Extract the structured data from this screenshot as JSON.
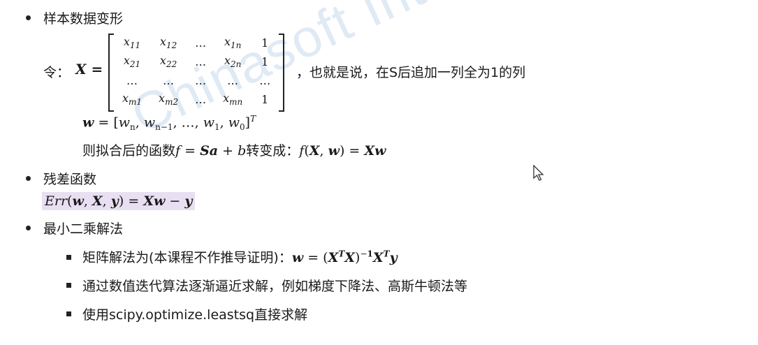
{
  "watermark": "Chinasoft International",
  "s1": {
    "bullet": "样本数据变形",
    "let_label": "令：",
    "x_symbol": "X",
    "matrix": [
      [
        "x11",
        "x12",
        "...",
        "x1n",
        "1"
      ],
      [
        "x21",
        "x22",
        "...",
        "x2n",
        "1"
      ],
      [
        "...",
        "...",
        "...",
        "...",
        "..."
      ],
      [
        "xm1",
        "xm2",
        "...",
        "xmn",
        "1"
      ]
    ],
    "after_matrix": "，也就是说，在S后追加一列全为1的列",
    "w_def": "w = [wn, wn−1, …, w1, w0]T",
    "fit_prefix": "则拟合后的函数",
    "fit_formula": "f = Sa + b",
    "fit_mid": "转变成：",
    "fit_result": "f(X, w) = Xw"
  },
  "s2": {
    "bullet": "残差函数",
    "formula": "Err(w, X, y) = Xw − y"
  },
  "s3": {
    "bullet": "最小二乘解法",
    "items": [
      {
        "text": "矩阵解法为(本课程不作推导证明)：",
        "formula": "w = (XTX)−1XTy"
      },
      {
        "text": "通过数值迭代算法逐渐逼近求解，例如梯度下降法、高斯牛顿法等"
      },
      {
        "text": "使用scipy.optimize.leastsq直接求解"
      }
    ]
  }
}
